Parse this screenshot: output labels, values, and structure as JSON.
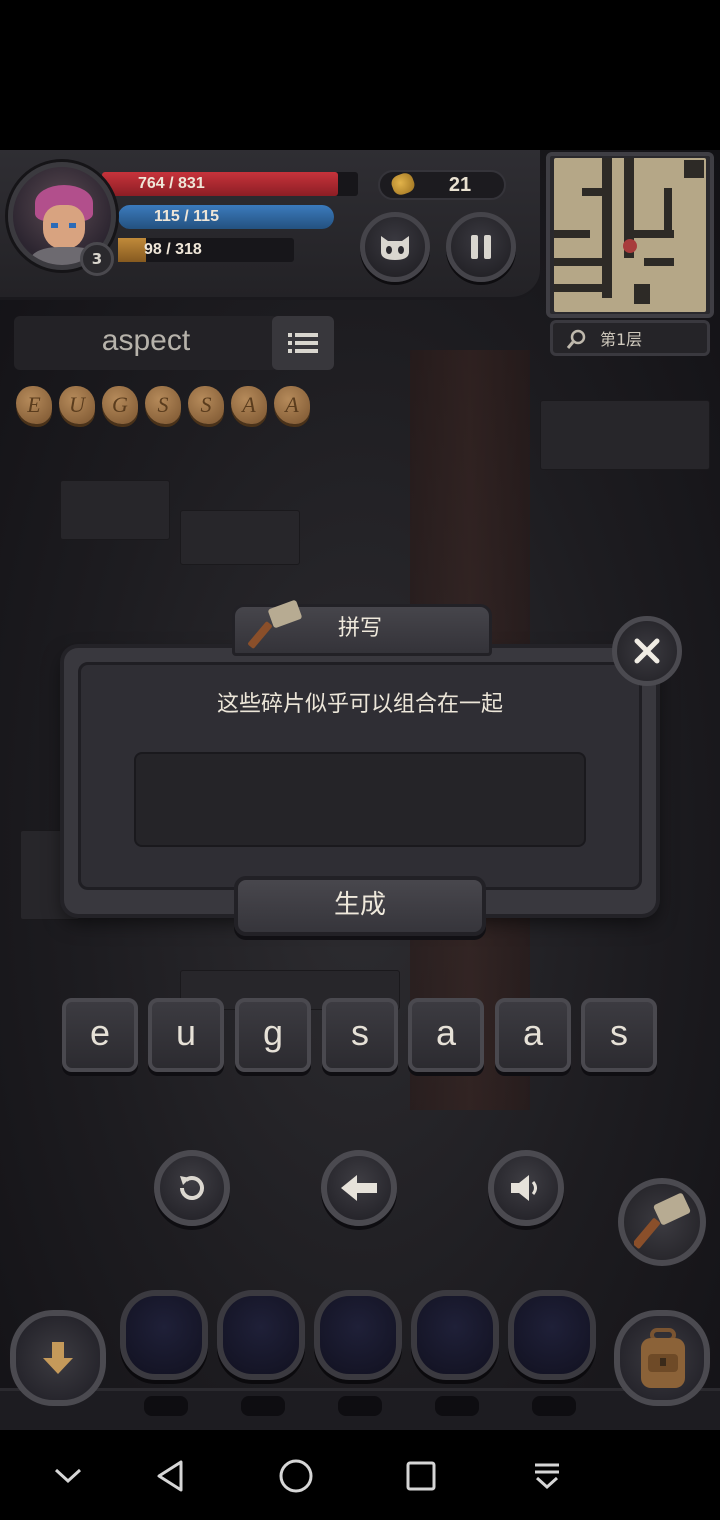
{
  "hud": {
    "hp": "764 / 831",
    "mp": "115 / 115",
    "xp": "98 / 318",
    "level": "3",
    "gold": "21",
    "floor_label": "第1层"
  },
  "target_word": "aspect",
  "fragments": [
    "E",
    "U",
    "G",
    "S",
    "S",
    "A",
    "A"
  ],
  "dialog": {
    "tab_title": "拼写",
    "message": "这些碎片似乎可以组合在一起",
    "input_value": "",
    "generate_label": "生成"
  },
  "letters": [
    "e",
    "u",
    "g",
    "s",
    "a",
    "a",
    "s"
  ],
  "controls": [
    "reset",
    "backspace",
    "sound"
  ],
  "colors": {
    "hp": "#c7333b",
    "mp": "#3b7bbd",
    "xp": "#c08a3a",
    "gold": "#e2b34a",
    "panel": "#39383e"
  }
}
